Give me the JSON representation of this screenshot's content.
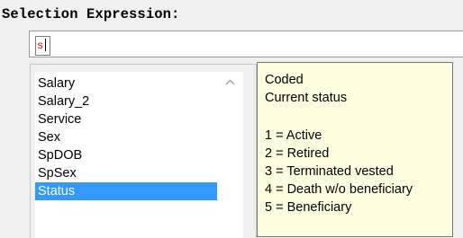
{
  "section_label": "Selection Expression:",
  "expression_input": {
    "value": "s"
  },
  "suggestions": {
    "items": [
      "Salary",
      "Salary_2",
      "Service",
      "Sex",
      "SpDOB",
      "SpSex",
      "Status"
    ],
    "selected_index": 6
  },
  "tooltip": {
    "type": "Coded",
    "description": "Current status",
    "codes": [
      "1 = Active",
      "2 = Retired",
      "3 = Terminated vested",
      "4 = Death w/o beneficiary",
      "5 = Beneficiary"
    ]
  },
  "icons": {
    "scroll_up": "chevron-up-icon"
  },
  "colors": {
    "selection": "#3399ff",
    "tooltip_bg": "#ffffe1",
    "input_text": "#e00000"
  }
}
